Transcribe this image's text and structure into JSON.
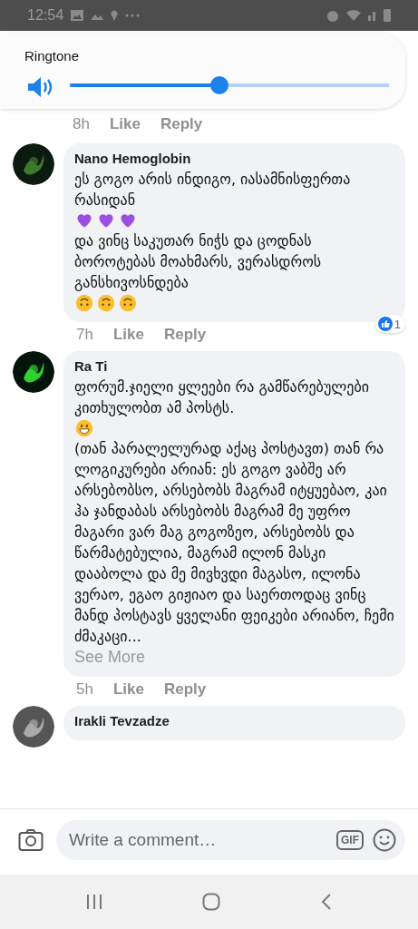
{
  "status_bar": {
    "time": "12:54"
  },
  "volume_panel": {
    "label": "Ringtone",
    "level": 0.47
  },
  "previous_comment": {
    "time": "8h",
    "like": "Like",
    "reply": "Reply"
  },
  "comments": [
    {
      "author": "Nano Hemoglobin",
      "parts": [
        {
          "kind": "text",
          "text": "ეს გოგო არის ინდიგო, იასამნისფერთა რასიდან"
        },
        {
          "kind": "heart"
        },
        {
          "kind": "heart"
        },
        {
          "kind": "heart"
        },
        {
          "kind": "text",
          "text": "და ვინც საკუთარ ნიჭს და ცოდნას ბოროტებას მოახმარს, ვერასდროს განსხივოსნდება"
        },
        {
          "kind": "upside"
        },
        {
          "kind": "upside"
        },
        {
          "kind": "upside"
        }
      ],
      "time": "7h",
      "like": "Like",
      "reply": "Reply",
      "like_count": "1"
    },
    {
      "author": "Ra Ti",
      "parts": [
        {
          "kind": "text",
          "text": "ფორუმ.ჯიელი ყლეები რა გამწარებულები კითხულობთ ამ პოსტს."
        },
        {
          "kind": "grin"
        },
        {
          "kind": "text",
          "text": "(თან პარალელურად აქაც პოსტავთ) თან რა ლოგიკურები არიან: ეს გოგო ვაბშე არ არსებობსო, არსებობს მაგრამ იტყუებაო, კაი ჰა ჯანდაბას არსებობს მაგრამ მე უფრო მაგარი ვარ მაგ გოგოზეო, არსებობს და წარმატებულია, მაგრამ ილონ მასკი დააბოლა და მე მივხვდი მაგასო, ილონა ვერაო, ეგაო გიჟიაო და საერთოდაც ვინც მანდ პოსტავს ყველანი ფეიკები არიანო, ჩემი ძმაკაცი..."
        }
      ],
      "see_more": "See More",
      "time": "5h",
      "like": "Like",
      "reply": "Reply"
    },
    {
      "author": "Irakli Tevzadze"
    }
  ],
  "composer": {
    "placeholder": "Write a comment…",
    "gif": "GIF"
  }
}
